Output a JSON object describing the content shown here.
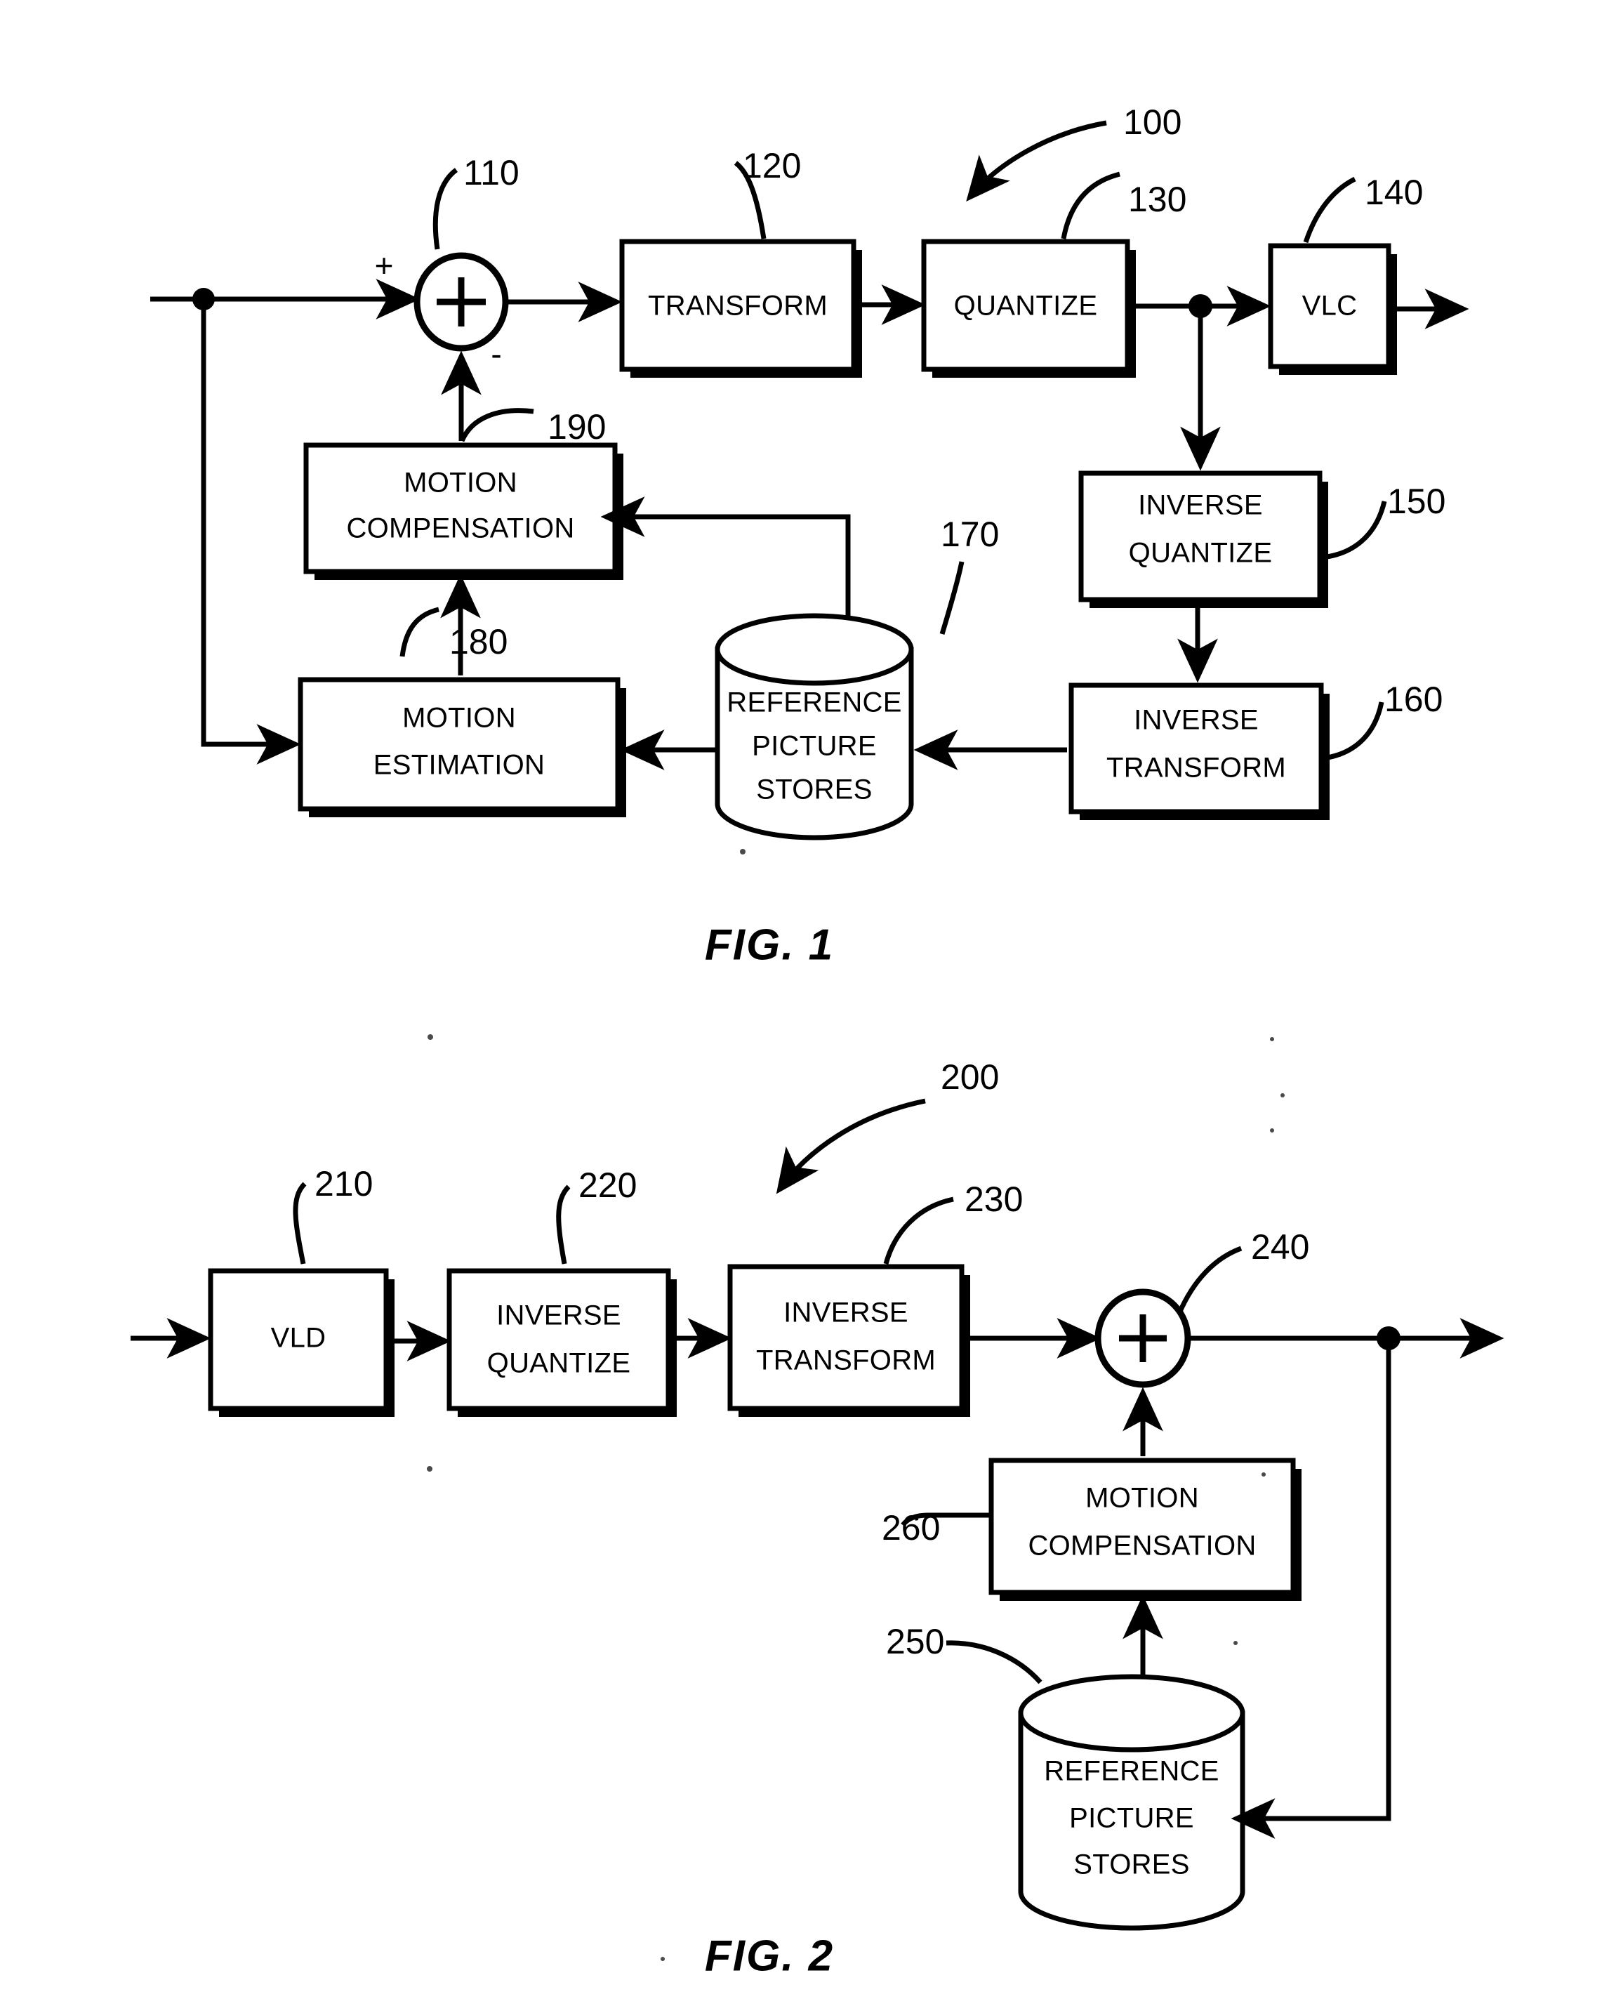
{
  "document": {
    "type": "patent-drawing-sheet",
    "figures": [
      {
        "caption": "FIG. 1",
        "system_ref": "100",
        "description": "Video encoder block diagram",
        "blocks": [
          {
            "ref": "110",
            "label": "",
            "shape": "summing-junction",
            "symbol": "+",
            "inputs": [
              "+",
              "-"
            ]
          },
          {
            "ref": "120",
            "label": "TRANSFORM",
            "shape": "rectangle"
          },
          {
            "ref": "130",
            "label": "QUANTIZE",
            "shape": "rectangle"
          },
          {
            "ref": "140",
            "label": "VLC",
            "shape": "rectangle"
          },
          {
            "ref": "150",
            "label": "INVERSE QUANTIZE",
            "line1": "INVERSE",
            "line2": "QUANTIZE",
            "shape": "rectangle"
          },
          {
            "ref": "160",
            "label": "INVERSE TRANSFORM",
            "line1": "INVERSE",
            "line2": "TRANSFORM",
            "shape": "rectangle"
          },
          {
            "ref": "170",
            "label": "REFERENCE PICTURE STORES",
            "line1": "REFERENCE",
            "line2": "PICTURE",
            "line3": "STORES",
            "shape": "cylinder"
          },
          {
            "ref": "180",
            "label": "MOTION ESTIMATION",
            "line1": "MOTION",
            "line2": "ESTIMATION",
            "shape": "rectangle"
          },
          {
            "ref": "190",
            "label": "MOTION COMPENSATION",
            "line1": "MOTION",
            "line2": "COMPENSATION",
            "shape": "rectangle"
          }
        ]
      },
      {
        "caption": "FIG. 2",
        "system_ref": "200",
        "description": "Video decoder block diagram",
        "blocks": [
          {
            "ref": "210",
            "label": "VLD",
            "shape": "rectangle"
          },
          {
            "ref": "220",
            "label": "INVERSE QUANTIZE",
            "line1": "INVERSE",
            "line2": "QUANTIZE",
            "shape": "rectangle"
          },
          {
            "ref": "230",
            "label": "INVERSE TRANSFORM",
            "line1": "INVERSE",
            "line2": "TRANSFORM",
            "shape": "rectangle"
          },
          {
            "ref": "240",
            "label": "",
            "shape": "summing-junction",
            "symbol": "+"
          },
          {
            "ref": "250",
            "label": "REFERENCE PICTURE STORES",
            "line1": "REFERENCE",
            "line2": "PICTURE",
            "line3": "STORES",
            "shape": "cylinder"
          },
          {
            "ref": "260",
            "label": "MOTION COMPENSATION",
            "line1": "MOTION",
            "line2": "COMPENSATION",
            "shape": "rectangle"
          }
        ]
      }
    ],
    "colors": {
      "ink": "#000000",
      "paper": "#ffffff"
    }
  },
  "fig1": {
    "caption": "FIG. 1",
    "ref_100": "100",
    "ref_110": "110",
    "ref_120": "120",
    "ref_130": "130",
    "ref_140": "140",
    "ref_150": "150",
    "ref_160": "160",
    "ref_170": "170",
    "ref_180": "180",
    "ref_190": "190",
    "plus_sign": "+",
    "minus_sign": "-",
    "adder_symbol": "+",
    "transform": "TRANSFORM",
    "quantize": "QUANTIZE",
    "vlc": "VLC",
    "inverse_l1": "INVERSE",
    "inverse_quantize_l2": "QUANTIZE",
    "inverse_transform_l2": "TRANSFORM",
    "ref_store_l1": "REFERENCE",
    "ref_store_l2": "PICTURE",
    "ref_store_l3": "STORES",
    "motion_l1": "MOTION",
    "motion_est_l2": "ESTIMATION",
    "motion_comp_l2": "COMPENSATION"
  },
  "fig2": {
    "caption": "FIG. 2",
    "ref_200": "200",
    "ref_210": "210",
    "ref_220": "220",
    "ref_230": "230",
    "ref_240": "240",
    "ref_250": "250",
    "ref_260": "260",
    "adder_symbol": "+",
    "vld": "VLD",
    "inverse_l1": "INVERSE",
    "inverse_quantize_l2": "QUANTIZE",
    "inverse_transform_l2": "TRANSFORM",
    "ref_store_l1": "REFERENCE",
    "ref_store_l2": "PICTURE",
    "ref_store_l3": "STORES",
    "motion_l1": "MOTION",
    "motion_comp_l2": "COMPENSATION"
  }
}
